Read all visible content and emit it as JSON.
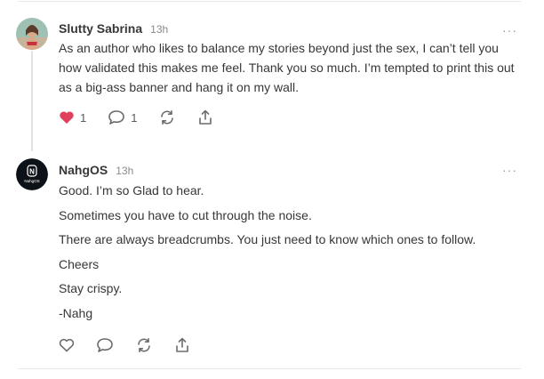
{
  "comments": [
    {
      "author": "Slutty Sabrina",
      "time": "13h",
      "paragraphs": [
        "As an author who likes to balance my stories beyond just the sex, I can’t tell you how validated this makes me feel. Thank you so much. I’m tempted to print this out as a big-ass banner and hang it on my wall."
      ],
      "likes": "1",
      "replies": "1",
      "liked": true
    },
    {
      "author": "NahgOS",
      "time": "13h",
      "avatar_text": "NahgOS",
      "paragraphs": [
        "Good. I’m so Glad to hear.",
        "Sometimes you have to cut through the noise.",
        "There are always breadcrumbs. You just need to know which ones to follow.",
        "Cheers",
        "Stay crispy.",
        "-Nahg"
      ],
      "liked": false
    }
  ],
  "more_label": "···",
  "colors": {
    "like_active": "#e0405a",
    "text": "#363737",
    "muted": "#8a8a8a"
  }
}
